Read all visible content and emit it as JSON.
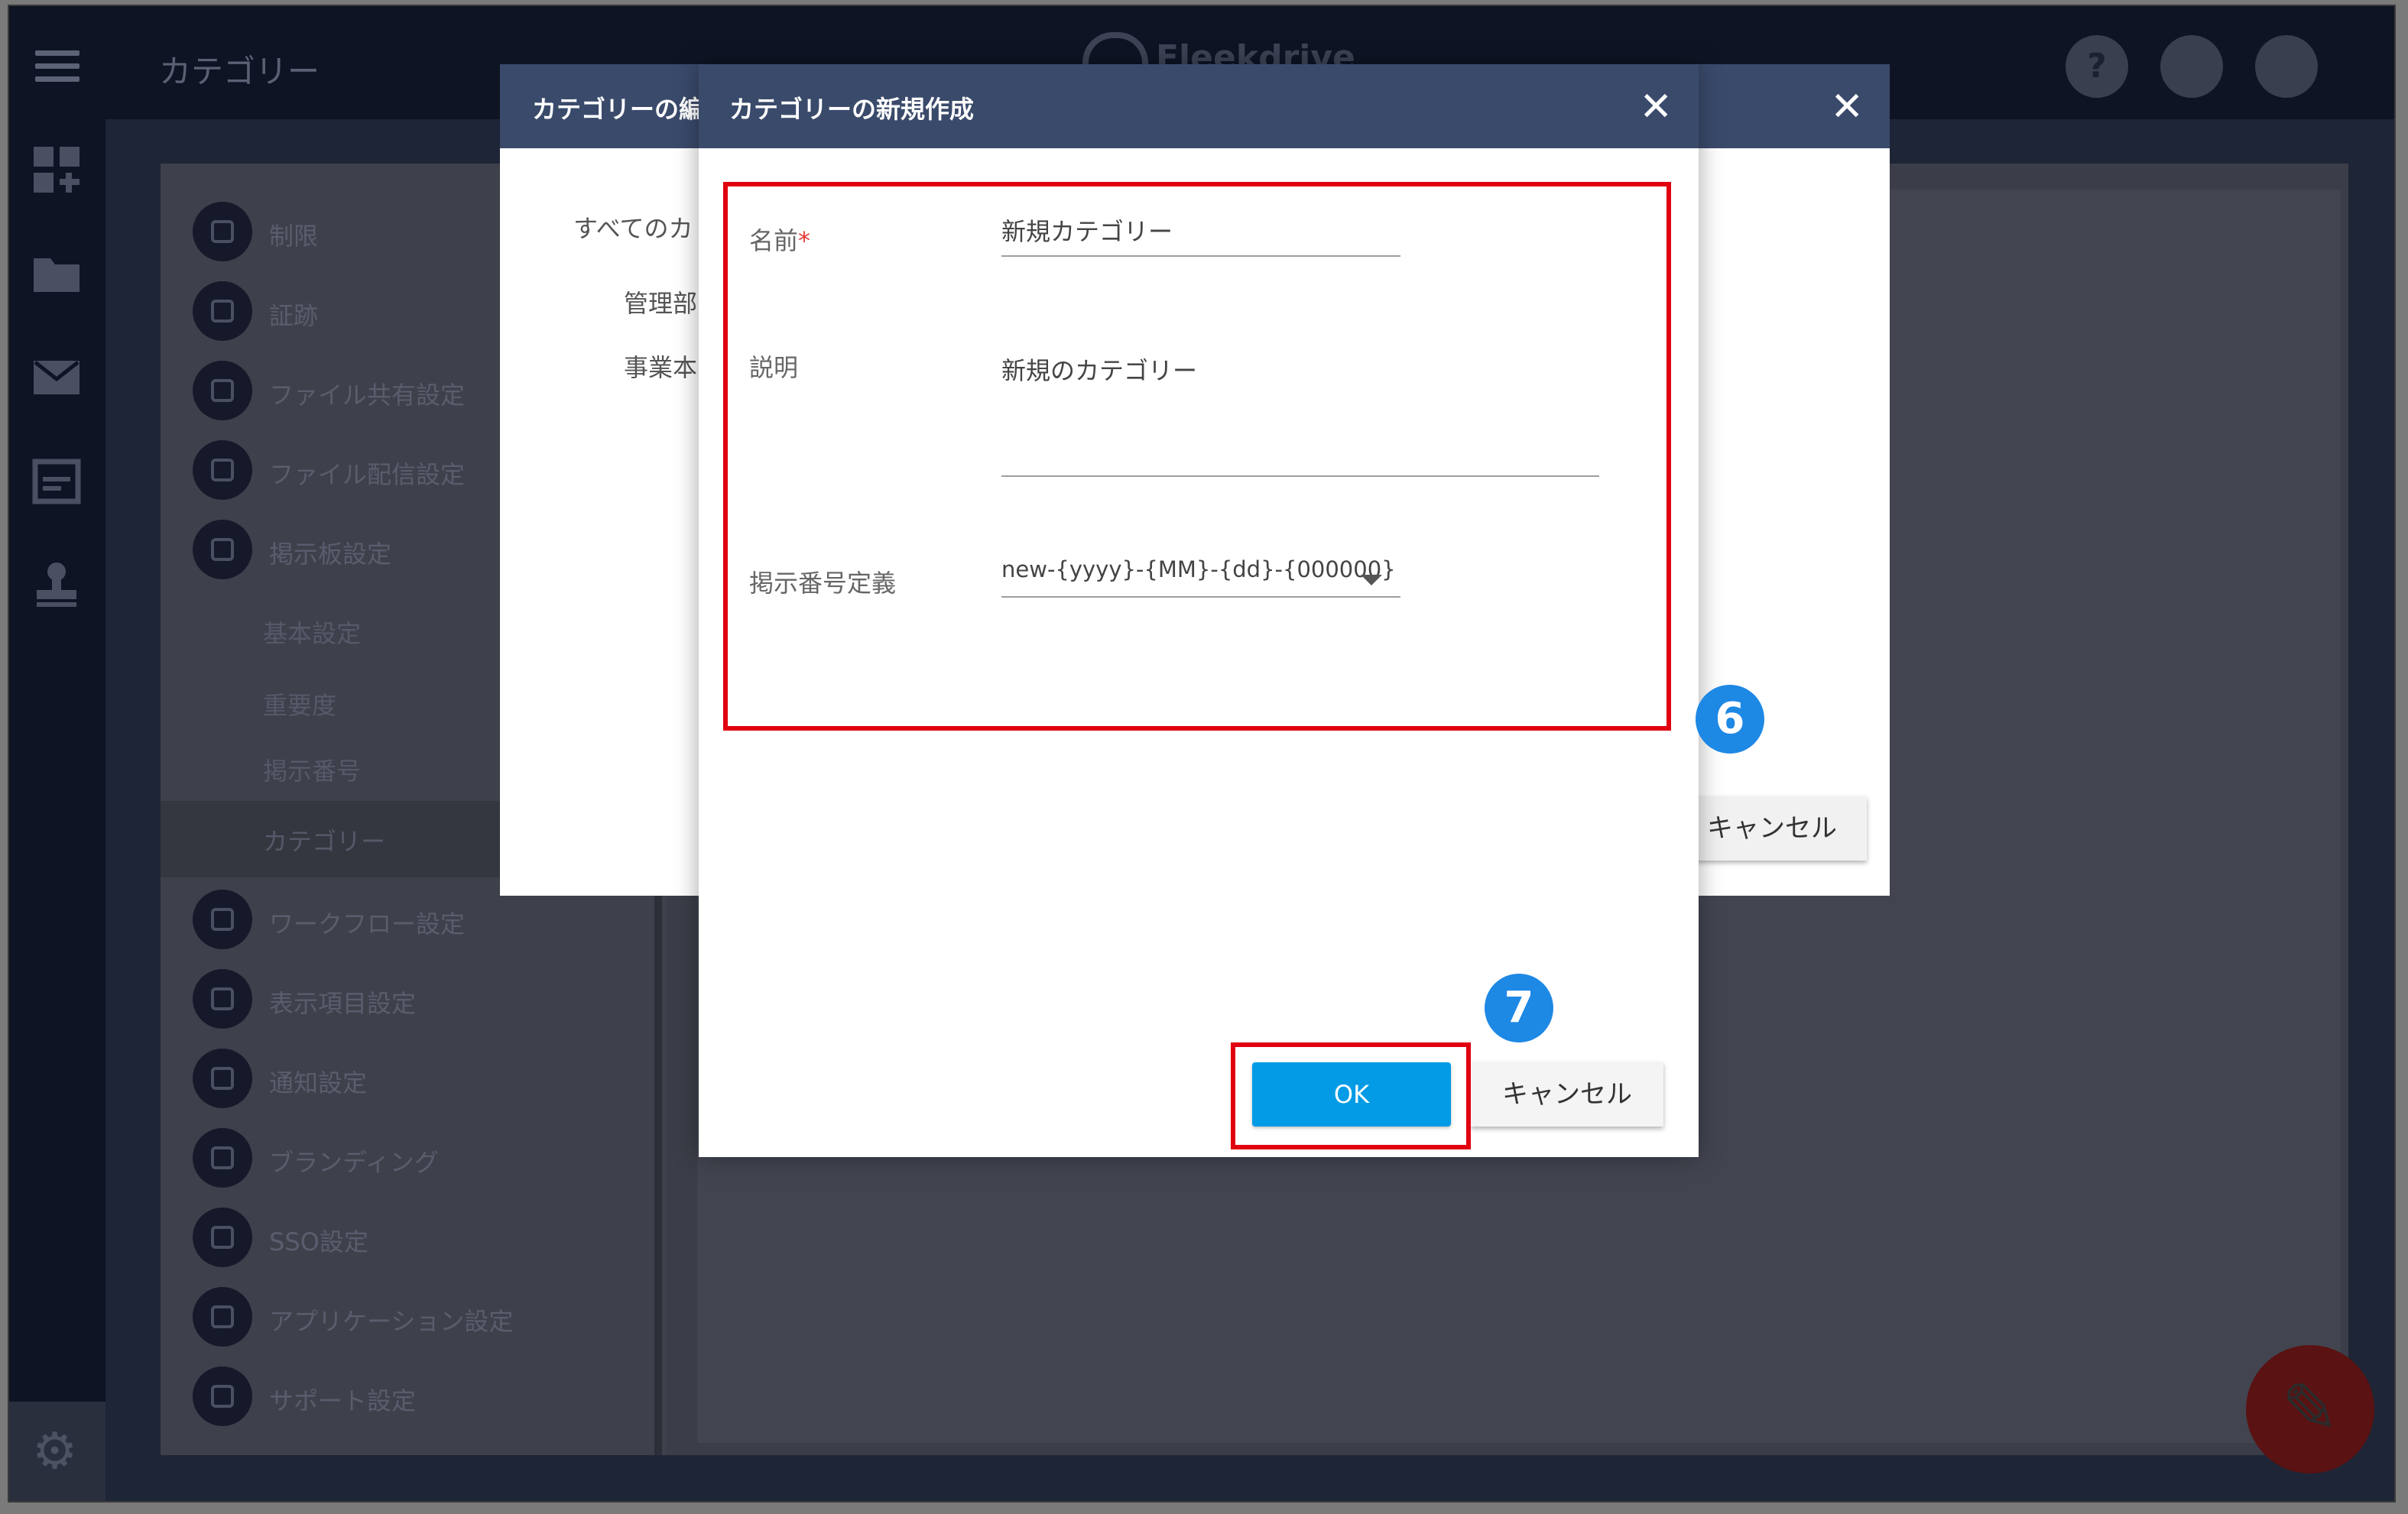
{
  "app": {
    "page_title": "カテゴリー",
    "brand": "Fleekdrive"
  },
  "topbar_icons": [
    "help-icon",
    "bell-icon",
    "user-icon"
  ],
  "topbar_help_glyph": "?",
  "rail_icons": [
    "dashboard-add-icon",
    "folder-icon",
    "mail-icon",
    "board-icon",
    "workflow-stamp-icon",
    "settings-icon"
  ],
  "sidebar": {
    "items": [
      {
        "label": "制限",
        "icon": "restriction-icon"
      },
      {
        "label": "証跡",
        "icon": "clock-icon"
      },
      {
        "label": "ファイル共有設定",
        "icon": "share-icon"
      },
      {
        "label": "ファイル配信設定",
        "icon": "mail-icon"
      },
      {
        "label": "掲示板設定",
        "icon": "calendar-icon"
      }
    ],
    "sub_items": [
      {
        "label": "基本設定"
      },
      {
        "label": "重要度"
      },
      {
        "label": "掲示番号"
      },
      {
        "label": "カテゴリー"
      }
    ],
    "items2": [
      {
        "label": "ワークフロー設定",
        "icon": "stamp-icon"
      },
      {
        "label": "表示項目設定",
        "icon": "list-icon"
      },
      {
        "label": "通知設定",
        "icon": "bell-icon"
      },
      {
        "label": "ブランディング",
        "icon": "branding-icon"
      },
      {
        "label": "SSO設定",
        "icon": "sso-icon"
      },
      {
        "label": "アプリケーション設定",
        "icon": "app-icon"
      },
      {
        "label": "サポート設定",
        "icon": "support-icon"
      }
    ]
  },
  "back_dialog": {
    "title": "カテゴリーの編",
    "tree_root": "すべてのカ",
    "tree_items": [
      "管理部",
      "事業本"
    ],
    "cancel_label": "キャンセル",
    "close_glyph": "✕"
  },
  "front_dialog": {
    "title": "カテゴリーの新規作成",
    "close_glyph": "✕",
    "name_label": "名前",
    "required_mark": "*",
    "name_value": "新規カテゴリー",
    "desc_label": "説明",
    "desc_value": "新規のカテゴリー",
    "number_label": "掲示番号定義",
    "number_value": "new-{yyyy}-{MM}-{dd}-{000000}",
    "ok_label": "OK",
    "cancel_label": "キャンセル"
  },
  "annotations": {
    "step6": "6",
    "step7": "7",
    "highlight_color": "#e00010",
    "badge_color": "#1e88e5"
  },
  "colors": {
    "dialog_header": "#3a4a6b",
    "ok_button": "#039be5"
  }
}
